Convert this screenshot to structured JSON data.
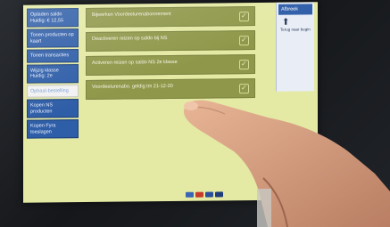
{
  "sidebar": {
    "items": [
      {
        "label": "Opladen saldo Huidig: € 12,55",
        "active": false
      },
      {
        "label": "Tonen producten op kaart",
        "active": false
      },
      {
        "label": "Tonen transacties",
        "active": false
      },
      {
        "label": "Wijzig klasse Huidig: 2e",
        "active": false
      },
      {
        "label": "Ophaal-bestelling",
        "active": true
      },
      {
        "label": "Kopen NS producten",
        "active": false
      },
      {
        "label": "Kopen Fyra toeslagen",
        "active": false
      }
    ]
  },
  "main": {
    "rows": [
      {
        "label": "Bijwerken Voordeelurenabonnement"
      },
      {
        "label": "Deactiveren reizen op saldo bij NS"
      },
      {
        "label": "Activeren reizen op saldo NS 2e klasse"
      },
      {
        "label": "Voordeelurenabo. geldig tm 21-12-20"
      }
    ]
  },
  "right": {
    "cancel_label": "Afbreek",
    "up_arrow": "⬆",
    "back_label": "Terug naar begin"
  },
  "colors": {
    "screen_bg": "#e4e9a4",
    "row_bg": "#8f984a",
    "nav_blue": "#2f5ea8"
  }
}
